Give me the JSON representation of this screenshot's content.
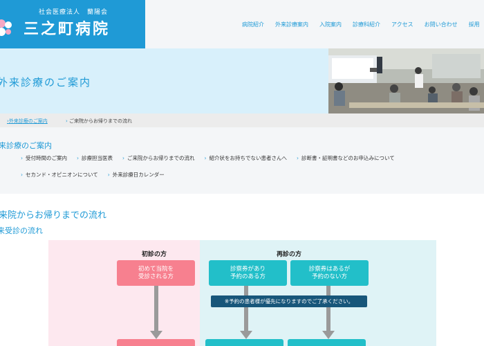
{
  "header": {
    "logo_sub": "社会医療法人　蘭陽会",
    "logo_main": "三之町病院",
    "nav": [
      "病院紹介",
      "外来診療案内",
      "入院案内",
      "診療科紹介",
      "アクセス",
      "お問い合わせ",
      "採用"
    ]
  },
  "hero": {
    "title": "外来診療のご案内"
  },
  "breadcrumb": {
    "link": "外来診療のご案内",
    "current": "ご来院からお帰りまでの流れ"
  },
  "subnav": {
    "title": "来診療のご案内",
    "row1": [
      "受付時間のご案内",
      "診療担当医表",
      "ご来院からお帰りまでの流れ",
      "紹介状をお持ちでない患者さんへ",
      "診断書・証明書などのお申込みについて"
    ],
    "row2": [
      "セカンド・オピニオンについて",
      "外来診療日カレンダー"
    ]
  },
  "section": {
    "title": "来院からお帰りまでの流れ",
    "subtitle": "来受診の流れ"
  },
  "flow": {
    "first_label": "初診の方",
    "return_label": "再診の方",
    "first_box": "初めて当院を\n受診される方",
    "return_box_a": "診察券があり\n予約のある方",
    "return_box_b": "診察券はあるが\n予約のない方",
    "note": "※予約の患者様が優先になりますのでご了承ください。"
  },
  "colors": {
    "brand_blue": "#1f9ad6",
    "pink_box": "#f7808f",
    "teal_box": "#22bfc9",
    "note_bg": "#17567a"
  }
}
